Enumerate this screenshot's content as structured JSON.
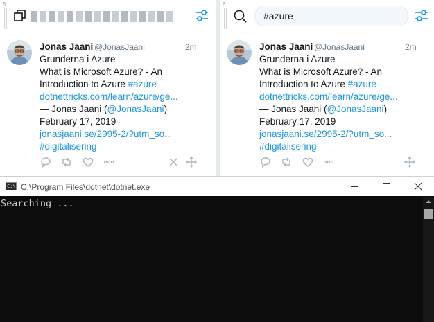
{
  "columns": [
    {
      "number": "5",
      "search_value": "",
      "tweet": {
        "name": "Jonas Jaani",
        "handle": "@JonasJaani",
        "time": "2m",
        "lines": [
          {
            "text": "Grunderna i Azure"
          },
          {
            "text": "What is Microsoft Azure? - An"
          },
          {
            "text": "Introduction to Azure ",
            "link": "#azure"
          },
          {
            "link": "dotnettricks.com/learn/azure/ge..."
          },
          {
            "text": "— Jonas Jaani (",
            "link": "@JonasJaani",
            "after": ")"
          },
          {
            "text": "February 17, 2019"
          },
          {
            "link": "jonasjaani.se/2995-2/?utm_so..."
          },
          {
            "link": "#digitalisering"
          }
        ]
      }
    },
    {
      "number": "6",
      "search_value": "#azure",
      "tweet": {
        "name": "Jonas Jaani",
        "handle": "@JonasJaani",
        "time": "2m",
        "lines": [
          {
            "text": "Grunderna i Azure"
          },
          {
            "text": "What is Microsoft Azure? - An"
          },
          {
            "text": "Introduction to Azure ",
            "link": "#azure"
          },
          {
            "link": "dotnettricks.com/learn/azure/ge..."
          },
          {
            "text": "— Jonas Jaani (",
            "link": "@JonasJaani",
            "after": ")"
          },
          {
            "text": "February 17, 2019"
          },
          {
            "link": "jonasjaani.se/2995-2/?utm_so..."
          },
          {
            "link": "#digitalisering"
          }
        ]
      }
    }
  ],
  "console": {
    "title": "C:\\Program Files\\dotnet\\dotnet.exe",
    "output": "Searching ...",
    "icon_text": "C:\\"
  },
  "colors": {
    "link": "#1b95e0",
    "accent": "#1da1f2",
    "console_bg": "#0c0c0c"
  },
  "icons": {
    "column_left_header": "copy-icon",
    "column_right_header": "search-icon",
    "filter": "sliders-icon",
    "reply": "reply-icon",
    "retweet": "retweet-icon",
    "like": "heart-icon",
    "more": "more-icon",
    "remove": "close-icon",
    "move": "move-icon"
  }
}
